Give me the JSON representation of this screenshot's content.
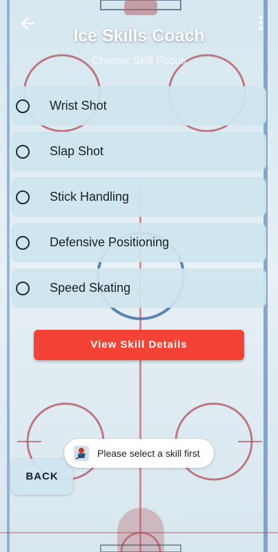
{
  "header": {
    "title": "Ice Skills Coach",
    "subtitle": "Choose Skill Focus"
  },
  "options": [
    {
      "label": "Wrist Shot",
      "selected": false
    },
    {
      "label": "Slap Shot",
      "selected": false
    },
    {
      "label": "Stick Handling",
      "selected": false
    },
    {
      "label": "Defensive Positioning",
      "selected": false
    },
    {
      "label": "Speed Skating",
      "selected": false
    }
  ],
  "actions": {
    "details_label": "View Skill Details",
    "back_label": "BACK"
  },
  "toast": {
    "message": "Please select a skill first"
  },
  "icons": {
    "nav_back": "arrow-left-icon",
    "overflow": "more-vert-icon",
    "toast_app": "hockey-app-icon"
  },
  "colors": {
    "accent": "#f44336",
    "option_bg": "#cfe5ee",
    "title": "#ffffff"
  }
}
